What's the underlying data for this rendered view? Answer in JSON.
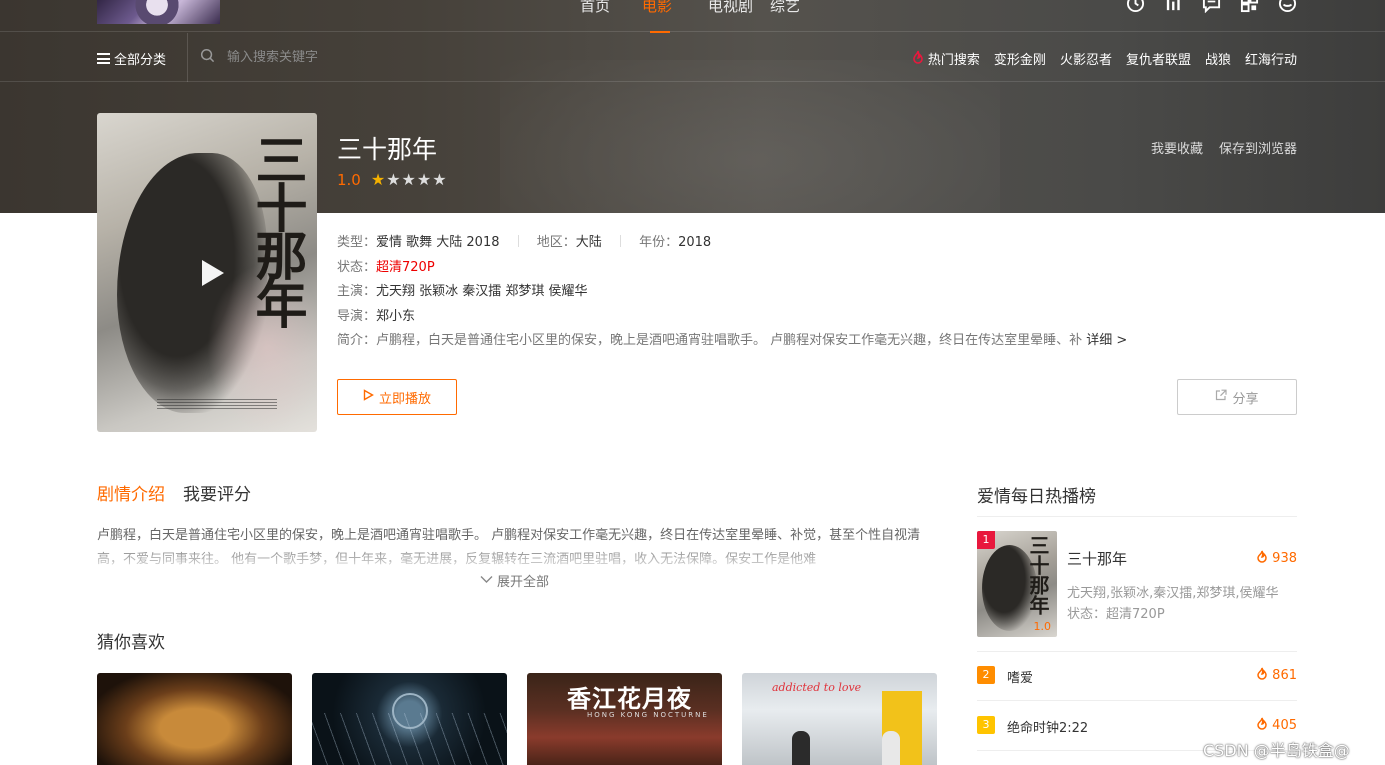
{
  "nav": {
    "items": [
      "首页",
      "电影",
      "电视剧",
      "综艺"
    ],
    "active": "电影"
  },
  "icons": [
    "history-icon",
    "chart-icon",
    "message-icon",
    "qrcode-icon",
    "user-icon"
  ],
  "subbar": {
    "category_label": "全部分类",
    "search_placeholder": "输入搜索关键字",
    "hot_label": "热门搜索",
    "hot_items": [
      "变形金刚",
      "火影忍者",
      "复仇者联盟",
      "战狼",
      "红海行动"
    ]
  },
  "movie": {
    "title": "三十那年",
    "poster_text": "三十那年",
    "score": "1.0",
    "stars_filled": 1,
    "stars_total": 5,
    "actions": [
      "我要收藏",
      "保存到浏览器"
    ],
    "type_label": "类型：",
    "type_value": "爱情 歌舞 大陆 2018",
    "region_label": "地区：",
    "region_value": "大陆",
    "year_label": "年份：",
    "year_value": "2018",
    "status_label": "状态：",
    "status_value": "超清720P",
    "cast_label": "主演：",
    "cast_value": "尤天翔 张颖冰 秦汉擂 郑梦琪 侯耀华",
    "director_label": "导演：",
    "director_value": "郑小东",
    "summary_label": "简介：",
    "summary_value": "卢鹏程，白天是普通住宅小区里的保安，晚上是酒吧通宵驻唱歌手。 卢鹏程对保安工作毫无兴趣，终日在传达室里晕睡、补",
    "more_label": "详细 >",
    "play_label": "立即播放",
    "share_label": "分享"
  },
  "tabs": [
    "剧情介绍",
    "我要评分"
  ],
  "plot": "卢鹏程，白天是普通住宅小区里的保安，晚上是酒吧通宵驻唱歌手。 卢鹏程对保安工作毫无兴趣，终日在传达室里晕睡、补觉，甚至个性自视清高，不爱与同事来往。 他有一个歌手梦，但十年来，毫无进展，反复辗转在三流酒吧里驻唱，收入无法保障。保安工作是他难",
  "expand_label": "展开全部",
  "guess": {
    "title": "猜你喜欢",
    "card_texts": {
      "c2_title": "香江花月夜",
      "c2_sub": "HONG KONG NOCTURNE",
      "c3_script": "addicted to love"
    }
  },
  "ranking": {
    "title": "爱情每日热播榜",
    "top": {
      "rank": "1",
      "name": "三十那年",
      "heat": "938",
      "cast": "尤天翔,张颖冰,秦汉擂,郑梦琪,侯耀华",
      "status": "状态：超清720P",
      "thumb_text": "三十那年",
      "thumb_score": "1.0"
    },
    "rows": [
      {
        "rank": "2",
        "name": "嗜爱",
        "heat": "861"
      },
      {
        "rank": "3",
        "name": "绝命时钟2:22",
        "heat": "405"
      }
    ]
  },
  "watermark": "CSDN @半岛铁盒@",
  "colors": {
    "accent": "#ff6a00",
    "status_red": "#ee0000",
    "rank1": "#e8183d",
    "rank2": "#ff8d00",
    "rank3": "#ffc400"
  }
}
